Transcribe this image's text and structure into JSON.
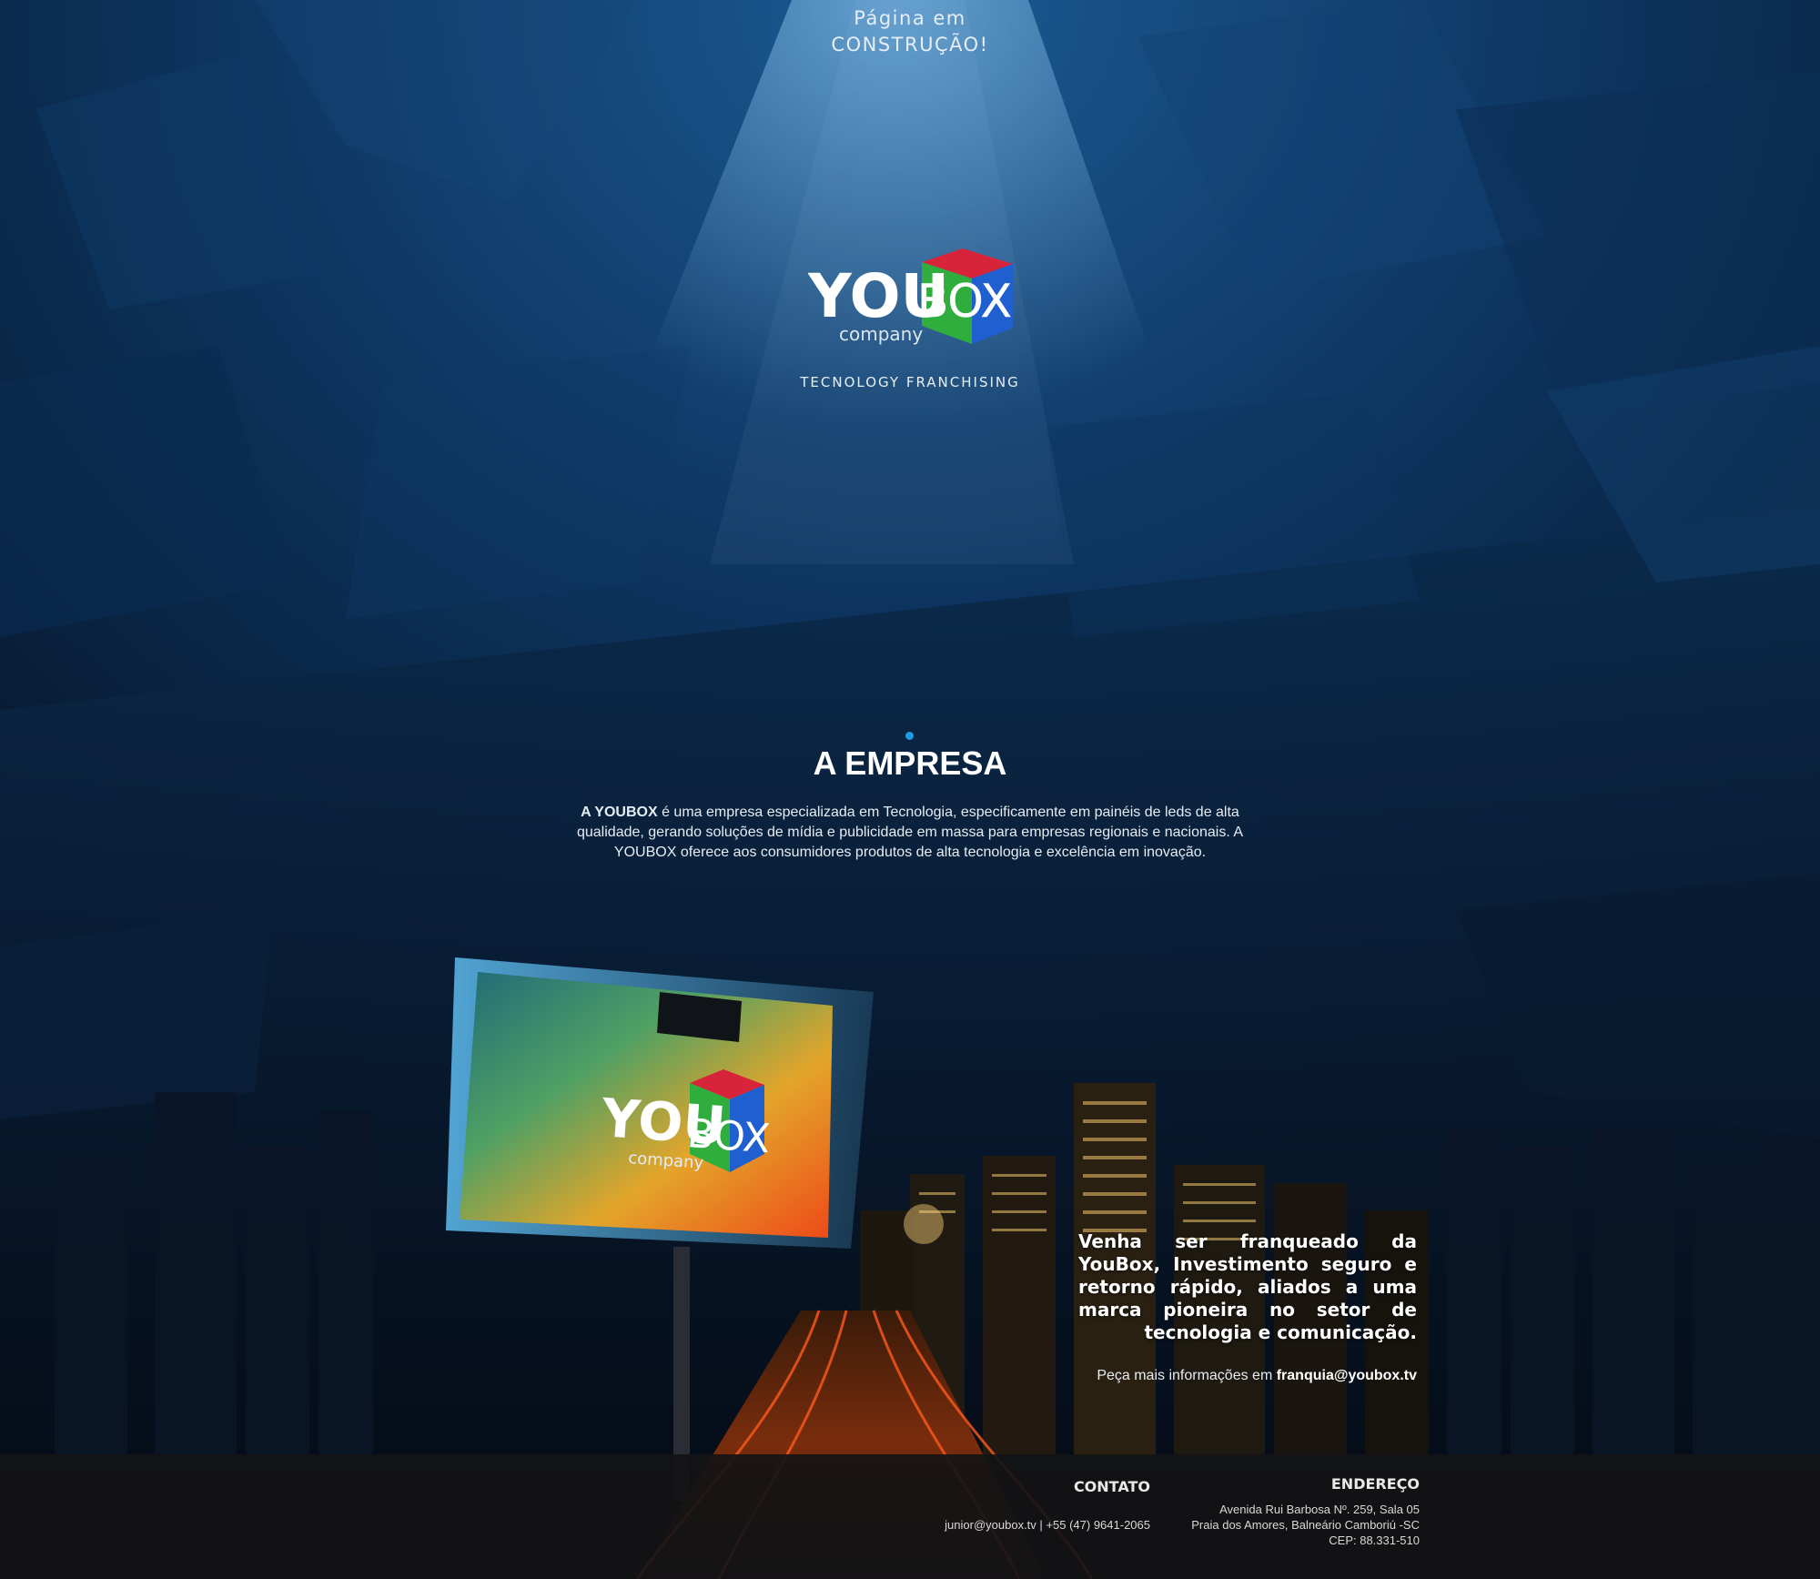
{
  "banner": {
    "line1": "Página em",
    "line2": "CONSTRUÇÃO!"
  },
  "brand": {
    "you": "YOU",
    "box": "BOX",
    "company": "company",
    "tagline": "TECNOLOGY FRANCHISING"
  },
  "empresa": {
    "title": "A EMPRESA",
    "lead": "A YOUBOX",
    "body": " é uma empresa especializada em Tecnologia, especificamente em painéis de leds de alta qualidade, gerando soluções de mídia e publicidade em massa para empresas regionais e nacionais. A YOUBOX oferece aos consumidores produtos de alta tecnologia e excelência em inovação."
  },
  "franchise": {
    "pitch": "Venha ser franqueado da YouBox, Investimento seguro e retorno rápido, aliados a uma marca pioneira no setor de tecnologia e comunicação.",
    "info_prefix": "Peça mais informações em ",
    "info_email": "franquia@youbox.tv"
  },
  "footer": {
    "contact_title": "CONTATO",
    "contact_email": "junior@youbox.tv",
    "contact_sep": "|",
    "contact_phone": "+55 (47) 9641-2065",
    "address_title": "ENDEREÇO",
    "address_line1": "Avenida  Rui Barbosa Nº. 259, Sala 05",
    "address_line2": "Praia dos Amores, Balneário Camboriú -SC",
    "address_line3": "CEP: 88.331-510"
  },
  "colors": {
    "background": "#0b1c33",
    "accent_dot": "#1e9be6",
    "cube_red": "#d8243a",
    "cube_blue": "#1f5fd0",
    "cube_green": "#2fae3e"
  }
}
